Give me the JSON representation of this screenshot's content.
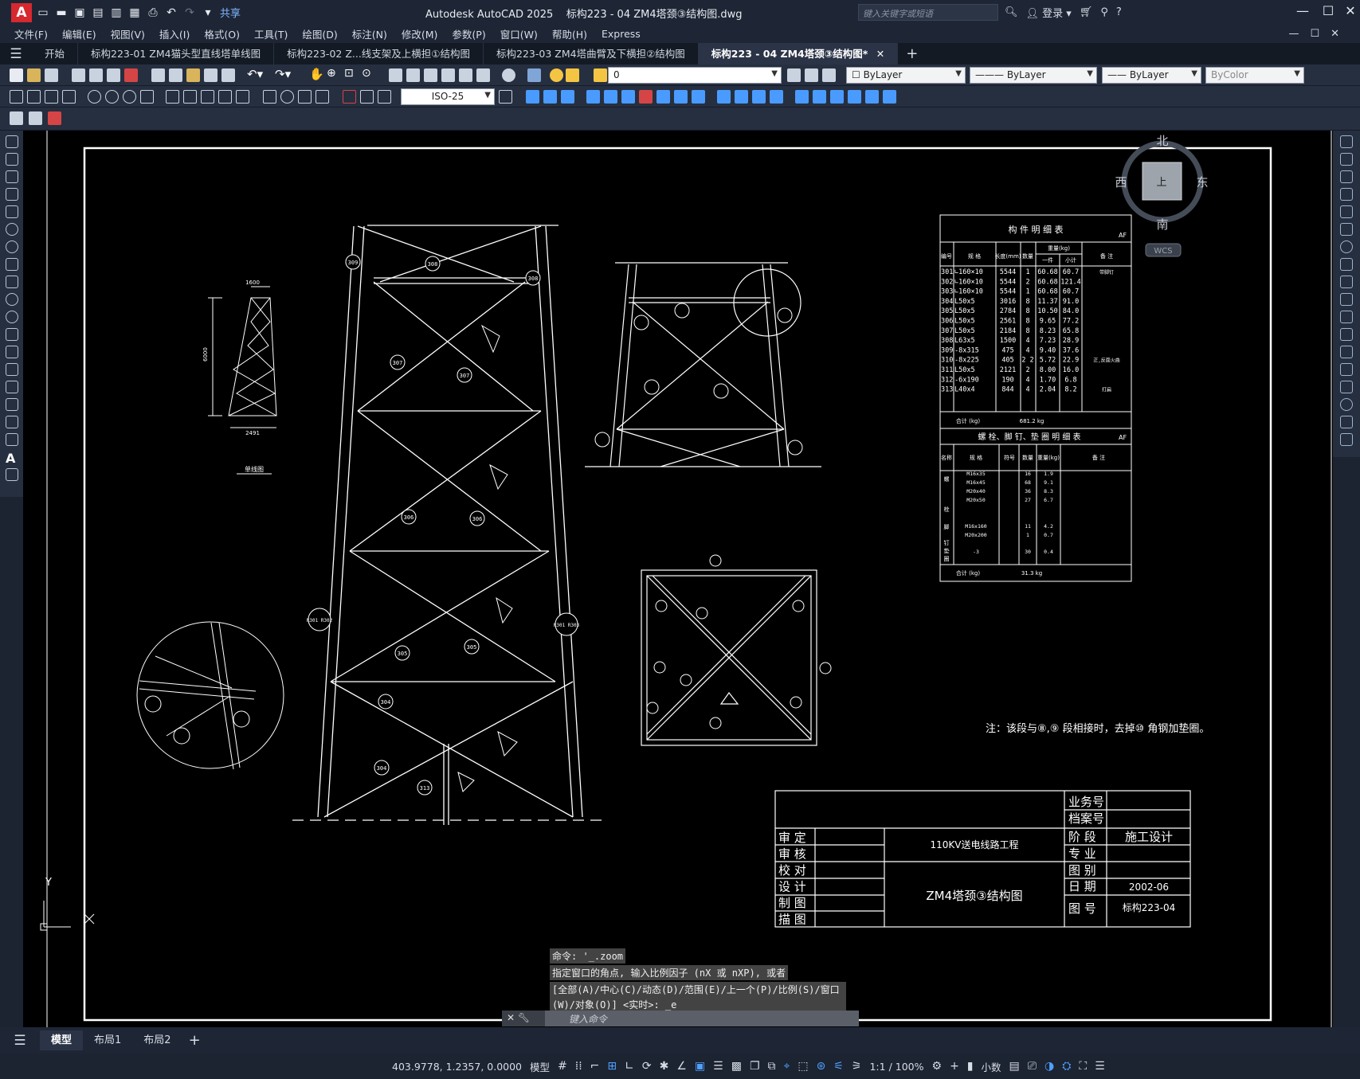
{
  "app": {
    "title": "Autodesk AutoCAD 2025",
    "document": "标构223 - 04 ZM4塔颈③结构图.dwg",
    "share": "共享",
    "search_placeholder": "键入关键字或短语",
    "signin": "登录"
  },
  "menus": [
    "文件(F)",
    "编辑(E)",
    "视图(V)",
    "插入(I)",
    "格式(O)",
    "工具(T)",
    "绘图(D)",
    "标注(N)",
    "修改(M)",
    "参数(P)",
    "窗口(W)",
    "帮助(H)",
    "Express"
  ],
  "doc_tabs": [
    "开始",
    "标构223-01 ZM4猫头型直线塔单线图",
    "标构223-02 Z...线支架及上横担①结构图",
    "标构223-03 ZM4塔曲臂及下横担②结构图",
    "标构223 - 04 ZM4塔颈③结构图*"
  ],
  "toolbar": {
    "layer": "0",
    "color": "ByLayer",
    "linetype": "ByLayer",
    "lineweight": "ByLayer",
    "plotstyle": "ByColor",
    "dimstyle": "ISO-25"
  },
  "viewcube": {
    "n": "北",
    "s": "南",
    "e": "东",
    "w": "西",
    "top": "上",
    "wcs": "WCS"
  },
  "drawing": {
    "single_line": {
      "w_top": "1600",
      "height": "6000",
      "w_bot": "2491",
      "caption": "单线图"
    },
    "parts_table": {
      "title": "构 件 明 细 表",
      "tag": "AF",
      "headers": [
        "编号",
        "规 格",
        "长度(mm)",
        "数量",
        "一件",
        "小计",
        "备 注"
      ],
      "weight_header": "重量(kg)",
      "rows": [
        [
          "301",
          "∟160×10",
          "5544",
          "1",
          "60.68",
          "60.7",
          "带脚钉"
        ],
        [
          "302",
          "∟160×10",
          "5544",
          "2",
          "60.68",
          "121.4",
          ""
        ],
        [
          "303",
          "∟160×10",
          "5544",
          "1",
          "60.68",
          "60.7",
          ""
        ],
        [
          "304",
          "L50x5",
          "3016",
          "8",
          "11.37",
          "91.0",
          ""
        ],
        [
          "305",
          "L50x5",
          "2784",
          "8",
          "10.50",
          "84.0",
          ""
        ],
        [
          "306",
          "L50x5",
          "2561",
          "8",
          "9.65",
          "77.2",
          ""
        ],
        [
          "307",
          "L50x5",
          "2184",
          "8",
          "8.23",
          "65.8",
          ""
        ],
        [
          "308",
          "L63x5",
          "1500",
          "4",
          "7.23",
          "28.9",
          ""
        ],
        [
          "309",
          "-8x315",
          "475",
          "4",
          "9.40",
          "37.6",
          ""
        ],
        [
          "310",
          "-8x225",
          "405",
          "2  2",
          "5.72",
          "22.9",
          "正,反面火曲"
        ],
        [
          "311",
          "L50x5",
          "2121",
          "2",
          "8.00",
          "16.0",
          ""
        ],
        [
          "312",
          "-6x190",
          "190",
          "4",
          "1.70",
          "6.8",
          ""
        ],
        [
          "313",
          "L40x4",
          "844",
          "4",
          "2.04",
          "8.2",
          "打扁"
        ]
      ],
      "total_label": "合计 (kg)",
      "total": "681.2 kg"
    },
    "bolt_table": {
      "title": "螺 栓、脚 钉、垫 圈 明 细 表",
      "tag": "AF",
      "headers": [
        "名称",
        "规 格",
        "符号",
        "数量",
        "重量(kg)",
        "备 注"
      ],
      "rows": [
        [
          "M16x35",
          "16",
          "1.9"
        ],
        [
          "M16x45",
          "68",
          "9.1"
        ],
        [
          "M20x40",
          "36",
          "8.3"
        ],
        [
          "M20x50",
          "27",
          "6.7"
        ],
        [
          "M16x160",
          "11",
          "4.2"
        ],
        [
          "M20x200",
          "1",
          "0.7"
        ],
        [
          "-3",
          "30",
          "0.4"
        ]
      ],
      "side_labels": [
        "螺",
        "栓",
        "脚",
        "钉",
        "垫",
        "圈"
      ],
      "total_label": "合计 (kg)",
      "total": "31.3 kg"
    },
    "note": "注：该段与⑧,⑨ 段相接时，去掉⑩ 角钢加垫圈。",
    "title_block": {
      "rows_left": [
        "审 定",
        "审 核",
        "校 对",
        "设 计",
        "制 图",
        "描 图"
      ],
      "project": "110KV送电线路工程",
      "drawing_name": "ZM4塔颈③结构图",
      "right_labels": [
        "业务号",
        "档案号",
        "阶 段",
        "专 业",
        "图 别",
        "日 期",
        "图 号"
      ],
      "stage": "施工设计",
      "date": "2002-06",
      "drawing_no": "标构223-04"
    },
    "tower_labels": [
      "309",
      "308",
      "308",
      "307",
      "307",
      "306",
      "306",
      "305",
      "305",
      "304",
      "304",
      "313",
      "R301 R302",
      "R301 R303"
    ]
  },
  "cmd": {
    "history": [
      "命令: '_.zoom",
      "指定窗口的角点, 输入比例因子 (nX 或 nXP), 或者",
      "[全部(A)/中心(C)/动态(D)/范围(E)/上一个(P)/比例(S)/窗口",
      "(W)/对象(O)] <实时>: _e"
    ],
    "placeholder": "键入命令"
  },
  "layouts": [
    "模型",
    "布局1",
    "布局2"
  ],
  "status": {
    "coords": "403.9778, 1.2357, 0.0000",
    "space": "模型",
    "scale": "1:1 / 100%",
    "units": "小数"
  }
}
